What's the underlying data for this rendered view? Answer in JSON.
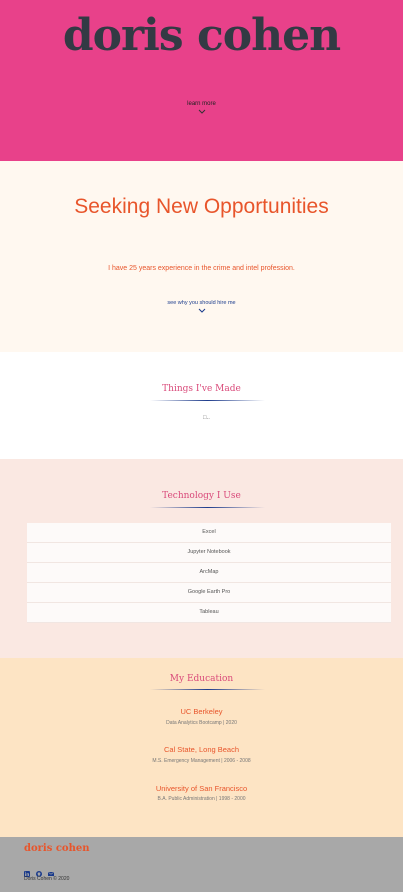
{
  "hero": {
    "title": "doris cohen",
    "learn_more": "learn more"
  },
  "opportunities": {
    "title": "Seeking New Opportunities",
    "text": "I have 25 years experience in the crime and intel profession.",
    "link": "see why you should hire me"
  },
  "made": {
    "title": "Things I've Made"
  },
  "tech": {
    "title": "Technology I Use",
    "items": [
      "Excel",
      "Jupyter Notebook",
      "ArcMap",
      "Google Earth Pro",
      "Tableau"
    ]
  },
  "education": {
    "title": "My Education",
    "entries": [
      {
        "school": "UC Berkeley",
        "detail": "Data Analytics Bootcamp | 2020"
      },
      {
        "school": "Cal State, Long Beach",
        "detail": "M.S. Emergency Management | 2006 - 2008"
      },
      {
        "school": "University of San Francisco",
        "detail": "B.A. Public Administration | 1998 - 2000"
      }
    ]
  },
  "footer": {
    "name": "doris cohen",
    "copyright": "Doris Cohen © 2020",
    "icons": [
      "linkedin-icon",
      "github-icon",
      "email-icon"
    ]
  },
  "colors": {
    "hero_bg": "#e8418a",
    "accent": "#e8552b",
    "link": "#1a3b8c"
  }
}
